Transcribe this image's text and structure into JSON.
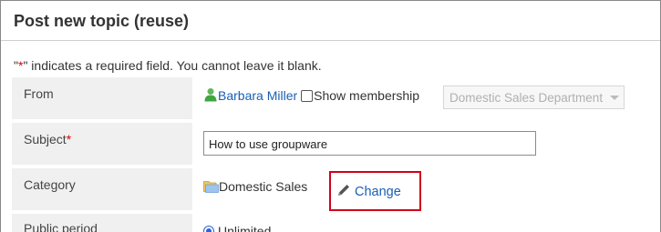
{
  "page": {
    "title": "Post new topic (reuse)",
    "required_note_prefix": "\"",
    "required_note_star": "*",
    "required_note_suffix": "\" indicates a required field. You cannot leave it blank."
  },
  "form": {
    "from": {
      "label": "From",
      "user_name": "Barbara Miller",
      "user_icon": "user-icon",
      "show_membership_label": "Show membership",
      "show_membership_checked": false,
      "department_select_value": "Domestic Sales Department"
    },
    "subject": {
      "label": "Subject",
      "required_mark": "*",
      "value": "How to use groupware"
    },
    "category": {
      "label": "Category",
      "folder_icon": "folder-icon",
      "value": "Domestic Sales",
      "change_label": "Change",
      "change_icon": "pencil-icon"
    },
    "public_period": {
      "label": "Public period",
      "option_selected": "Unlimited"
    }
  },
  "colors": {
    "link": "#1a5fb4",
    "required": "#e00000",
    "highlight_box": "#d0021b",
    "label_bg": "#f0f0f0",
    "radio": "#2a66d6"
  }
}
